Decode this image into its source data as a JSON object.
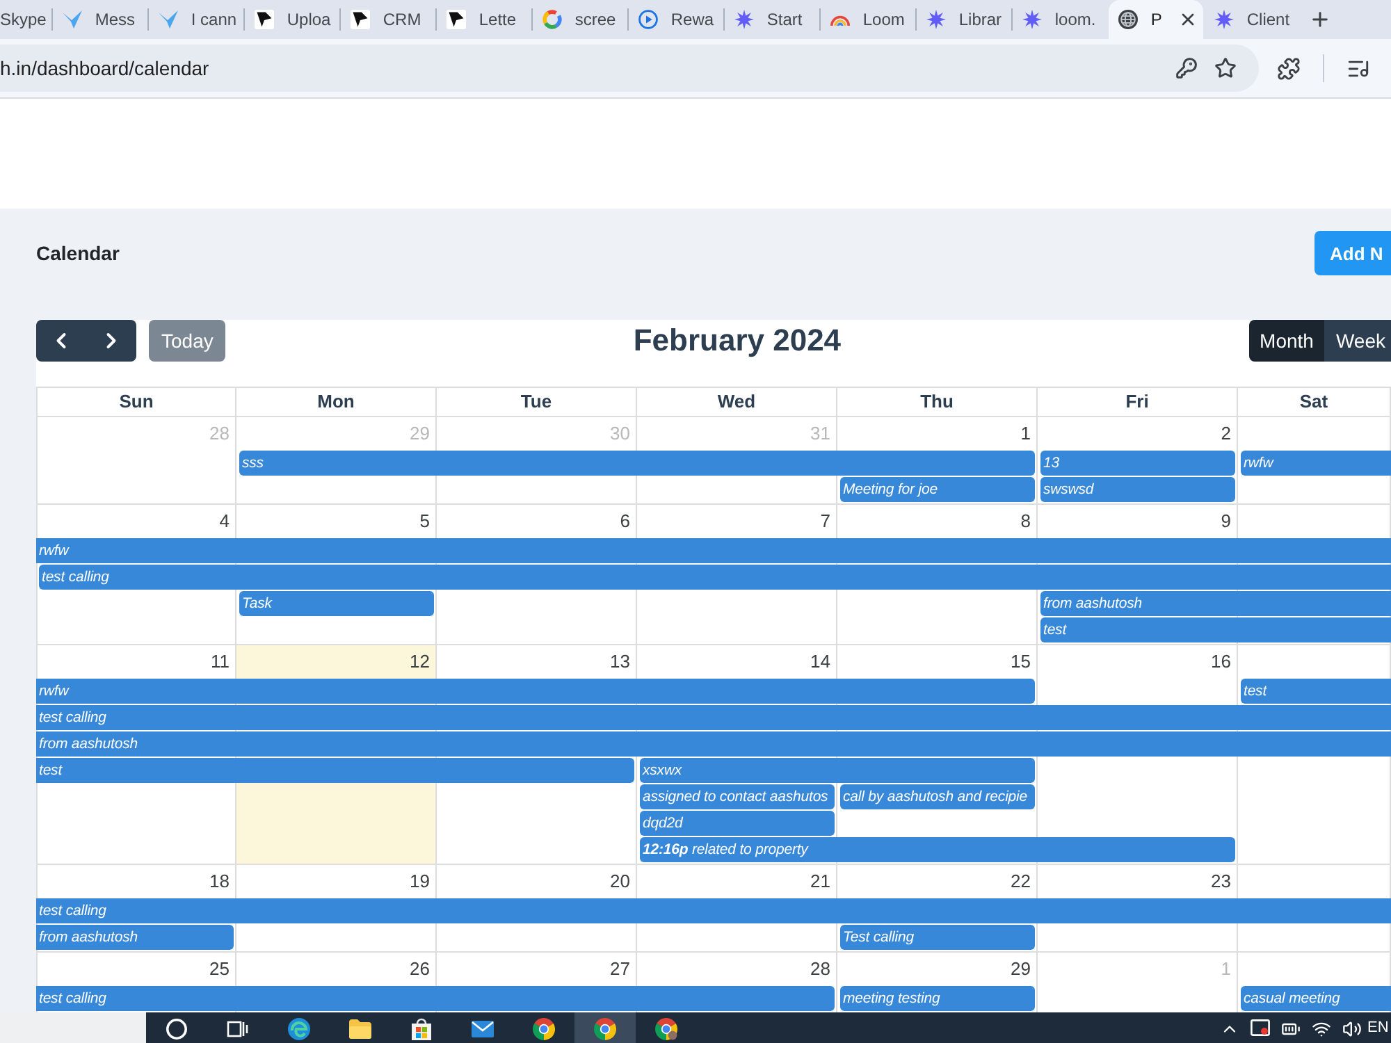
{
  "browser": {
    "tabs": [
      {
        "title": "Skype",
        "kind": "none",
        "selected": false
      },
      {
        "title": "Mess",
        "kind": "bird",
        "selected": false
      },
      {
        "title": "I cann",
        "kind": "bird",
        "selected": false
      },
      {
        "title": "Uploa",
        "kind": "logo",
        "selected": false
      },
      {
        "title": "CRM",
        "kind": "logo",
        "selected": false
      },
      {
        "title": "Lette",
        "kind": "logo",
        "selected": false
      },
      {
        "title": "scree",
        "kind": "ring",
        "selected": false
      },
      {
        "title": "Rewa",
        "kind": "play",
        "selected": false
      },
      {
        "title": "Start",
        "kind": "sparkle",
        "selected": false
      },
      {
        "title": "Loom",
        "kind": "arc",
        "selected": false
      },
      {
        "title": "Librar",
        "kind": "sparkle",
        "selected": false
      },
      {
        "title": "loom.",
        "kind": "sparkle",
        "selected": false
      },
      {
        "title": "P",
        "kind": "globe",
        "selected": true
      },
      {
        "title": "Client",
        "kind": "sparkle",
        "selected": false
      }
    ],
    "address": {
      "url": "h.in/dashboard/calendar"
    }
  },
  "page": {
    "title": "Calendar",
    "add_button": "Add N"
  },
  "calendar": {
    "title": "February 2024",
    "today_button": {
      "label": "Today",
      "disabled": true
    },
    "views": [
      {
        "label": "Month",
        "selected": true
      },
      {
        "label": "Week",
        "selected": false
      }
    ],
    "weekdays": [
      "Sun",
      "Mon",
      "Tue",
      "Wed",
      "Thu",
      "Fri",
      "Sat"
    ],
    "weeks": [
      {
        "days": [
          {
            "number": "28",
            "other_month": true,
            "today": false
          },
          {
            "number": "29",
            "other_month": true,
            "today": false
          },
          {
            "number": "30",
            "other_month": true,
            "today": false
          },
          {
            "number": "31",
            "other_month": true,
            "today": false
          },
          {
            "number": "1",
            "other_month": false,
            "today": false
          },
          {
            "number": "2",
            "other_month": false,
            "today": false
          }
        ],
        "lanes": [
          [
            {
              "kind": "gap"
            },
            {
              "kind": "event",
              "title": "sss",
              "starts_before": false
            },
            {
              "kind": "more"
            },
            {
              "kind": "more"
            },
            {
              "kind": "more"
            },
            {
              "kind": "event",
              "title": "13",
              "starts_before": false
            },
            {
              "kind": "event",
              "title": "rwfw",
              "starts_before": false
            }
          ],
          [
            {
              "kind": "gap"
            },
            {
              "kind": "gap"
            },
            {
              "kind": "gap"
            },
            {
              "kind": "gap"
            },
            {
              "kind": "event",
              "title": "Meeting for joe",
              "starts_before": false
            },
            {
              "kind": "event",
              "title": "swswsd",
              "starts_before": false
            }
          ]
        ]
      },
      {
        "days": [
          {
            "number": "4",
            "other_month": false,
            "today": false
          },
          {
            "number": "5",
            "other_month": false,
            "today": false
          },
          {
            "number": "6",
            "other_month": false,
            "today": false
          },
          {
            "number": "7",
            "other_month": false,
            "today": false
          },
          {
            "number": "8",
            "other_month": false,
            "today": false
          },
          {
            "number": "9",
            "other_month": false,
            "today": false
          }
        ],
        "lanes": [
          [
            {
              "kind": "event",
              "title": "rwfw",
              "starts_before": true
            },
            {
              "kind": "more"
            },
            {
              "kind": "more"
            },
            {
              "kind": "more"
            },
            {
              "kind": "more"
            },
            {
              "kind": "more"
            },
            {
              "kind": "more"
            }
          ],
          [
            {
              "kind": "event",
              "title": "test calling",
              "starts_before": false
            },
            {
              "kind": "more"
            },
            {
              "kind": "more"
            },
            {
              "kind": "more"
            },
            {
              "kind": "more"
            },
            {
              "kind": "more"
            },
            {
              "kind": "more"
            }
          ],
          [
            {
              "kind": "gap"
            },
            {
              "kind": "event",
              "title": "Task",
              "starts_before": false
            },
            {
              "kind": "gap"
            },
            {
              "kind": "gap"
            },
            {
              "kind": "gap"
            },
            {
              "kind": "event",
              "title": "from aashutosh",
              "starts_before": false
            },
            {
              "kind": "more"
            }
          ],
          [
            {
              "kind": "gap"
            },
            {
              "kind": "gap"
            },
            {
              "kind": "gap"
            },
            {
              "kind": "gap"
            },
            {
              "kind": "gap"
            },
            {
              "kind": "event",
              "title": "test",
              "starts_before": false
            },
            {
              "kind": "more"
            }
          ]
        ]
      },
      {
        "days": [
          {
            "number": "11",
            "other_month": false,
            "today": false
          },
          {
            "number": "12",
            "other_month": false,
            "today": true
          },
          {
            "number": "13",
            "other_month": false,
            "today": false
          },
          {
            "number": "14",
            "other_month": false,
            "today": false
          },
          {
            "number": "15",
            "other_month": false,
            "today": false
          },
          {
            "number": "16",
            "other_month": false,
            "today": false
          }
        ],
        "lanes": [
          [
            {
              "kind": "event",
              "title": "rwfw",
              "starts_before": true
            },
            {
              "kind": "more"
            },
            {
              "kind": "more"
            },
            {
              "kind": "more"
            },
            {
              "kind": "more"
            },
            {
              "kind": "gap"
            },
            {
              "kind": "event",
              "title": "test",
              "starts_before": false
            }
          ],
          [
            {
              "kind": "event",
              "title": "test calling",
              "starts_before": true
            },
            {
              "kind": "more"
            },
            {
              "kind": "more"
            },
            {
              "kind": "more"
            },
            {
              "kind": "more"
            },
            {
              "kind": "more"
            },
            {
              "kind": "more"
            }
          ],
          [
            {
              "kind": "event",
              "title": "from aashutosh",
              "starts_before": true
            },
            {
              "kind": "more"
            },
            {
              "kind": "more"
            },
            {
              "kind": "more"
            },
            {
              "kind": "more"
            },
            {
              "kind": "more"
            },
            {
              "kind": "more"
            }
          ],
          [
            {
              "kind": "event",
              "title": "test",
              "starts_before": true
            },
            {
              "kind": "more"
            },
            {
              "kind": "more"
            },
            {
              "kind": "event",
              "title": "xsxwx",
              "starts_before": false
            },
            {
              "kind": "more"
            }
          ],
          [
            {
              "kind": "gap"
            },
            {
              "kind": "gap"
            },
            {
              "kind": "gap"
            },
            {
              "kind": "event",
              "title": "assigned to contact aashutos",
              "starts_before": false
            },
            {
              "kind": "event",
              "title": "call by aashutosh and recipie",
              "starts_before": false
            }
          ],
          [
            {
              "kind": "gap"
            },
            {
              "kind": "gap"
            },
            {
              "kind": "gap"
            },
            {
              "kind": "event",
              "title": "dqd2d",
              "starts_before": false
            }
          ],
          [
            {
              "kind": "gap"
            },
            {
              "kind": "gap"
            },
            {
              "kind": "gap"
            },
            {
              "kind": "event",
              "title": "**12:16p** related to property",
              "starts_before": false
            },
            {
              "kind": "more"
            },
            {
              "kind": "more"
            }
          ]
        ]
      },
      {
        "days": [
          {
            "number": "18",
            "other_month": false,
            "today": false
          },
          {
            "number": "19",
            "other_month": false,
            "today": false
          },
          {
            "number": "20",
            "other_month": false,
            "today": false
          },
          {
            "number": "21",
            "other_month": false,
            "today": false
          },
          {
            "number": "22",
            "other_month": false,
            "today": false
          },
          {
            "number": "23",
            "other_month": false,
            "today": false
          }
        ],
        "lanes": [
          [
            {
              "kind": "event",
              "title": "test calling",
              "starts_before": true
            },
            {
              "kind": "more"
            },
            {
              "kind": "more"
            },
            {
              "kind": "more"
            },
            {
              "kind": "more"
            },
            {
              "kind": "more"
            },
            {
              "kind": "more"
            }
          ],
          [
            {
              "kind": "event",
              "title": "from aashutosh",
              "starts_before": true
            },
            {
              "kind": "gap"
            },
            {
              "kind": "gap"
            },
            {
              "kind": "gap"
            },
            {
              "kind": "event",
              "title": "Test calling",
              "starts_before": false
            }
          ]
        ]
      },
      {
        "days": [
          {
            "number": "25",
            "other_month": false,
            "today": false
          },
          {
            "number": "26",
            "other_month": false,
            "today": false
          },
          {
            "number": "27",
            "other_month": false,
            "today": false
          },
          {
            "number": "28",
            "other_month": false,
            "today": false
          },
          {
            "number": "29",
            "other_month": false,
            "today": false
          },
          {
            "number": "1",
            "other_month": true,
            "today": false
          }
        ],
        "lanes": [
          [
            {
              "kind": "event",
              "title": "test calling",
              "starts_before": true
            },
            {
              "kind": "more"
            },
            {
              "kind": "more"
            },
            {
              "kind": "more"
            },
            {
              "kind": "event",
              "title": "meeting testing",
              "starts_before": false
            },
            {
              "kind": "gap"
            },
            {
              "kind": "event",
              "title": "casual meeting",
              "starts_before": false
            }
          ]
        ]
      }
    ]
  },
  "taskbar": {
    "apps": [
      {
        "kind": "search",
        "active": false
      },
      {
        "kind": "taskview",
        "active": false
      },
      {
        "kind": "swirl",
        "active": false
      },
      {
        "kind": "folder",
        "active": false
      },
      {
        "kind": "store",
        "active": false
      },
      {
        "kind": "mail",
        "active": false
      },
      {
        "kind": "browser",
        "active": false
      },
      {
        "kind": "browser",
        "active": true
      },
      {
        "kind": "profile",
        "active": false
      }
    ],
    "language": "EN"
  }
}
